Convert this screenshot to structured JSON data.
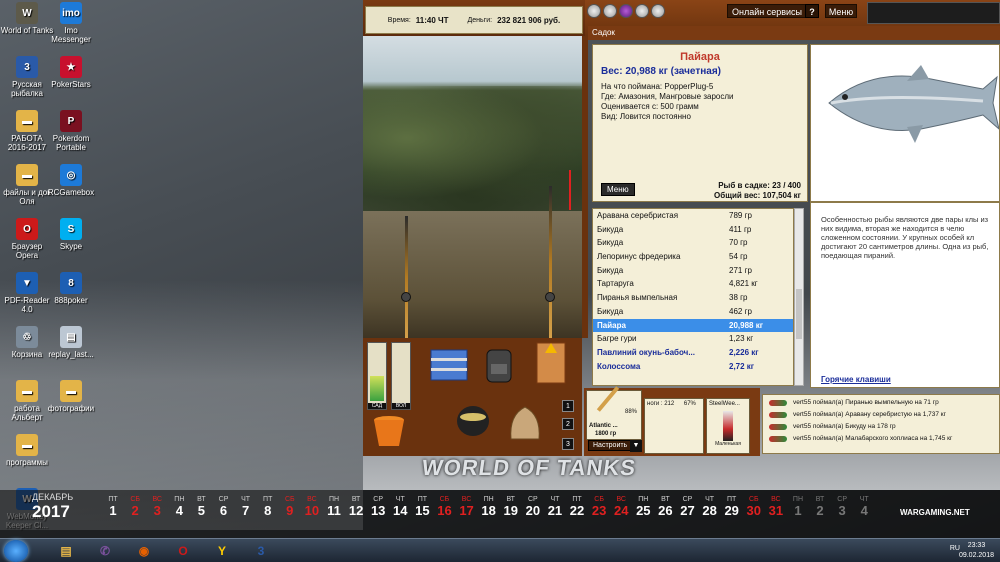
{
  "desktop": {
    "icons": [
      {
        "label": "World of Tanks",
        "glyph": "W",
        "color": "#5d5a4a"
      },
      {
        "label": "Imo Messenger",
        "glyph": "imo",
        "color": "#1d7ad8"
      },
      {
        "label": "Русская рыбалка",
        "glyph": "3",
        "color": "#2a5aa8"
      },
      {
        "label": "PokerStars",
        "glyph": "★",
        "color": "#c8102e"
      },
      {
        "label": "РАБОТА 2016-2017",
        "glyph": "▬",
        "color": "#e3b448"
      },
      {
        "label": "Pokerdom Portable",
        "glyph": "P",
        "color": "#7a1020"
      },
      {
        "label": "файлы и док Оля",
        "glyph": "▬",
        "color": "#e3b448"
      },
      {
        "label": "RCGamebox",
        "glyph": "◎",
        "color": "#1d7ad8"
      },
      {
        "label": "Браузер Opera",
        "glyph": "O",
        "color": "#cc1a1a"
      },
      {
        "label": "Skype",
        "glyph": "S",
        "color": "#00aff0"
      },
      {
        "label": "PDF-Reader 4.0",
        "glyph": "▼",
        "color": "#1d5fb3"
      },
      {
        "label": "888poker",
        "glyph": "8",
        "color": "#1d5fb3"
      },
      {
        "label": "Корзина",
        "glyph": "♲",
        "color": "#7c8b9a"
      },
      {
        "label": "replay_last...",
        "glyph": "▤",
        "color": "#bcc7d3"
      },
      {
        "label": "работа Альберт",
        "glyph": "▬",
        "color": "#e3b448"
      },
      {
        "label": "фотографии",
        "glyph": "▬",
        "color": "#e3b448"
      },
      {
        "label": "программы",
        "glyph": "▬",
        "color": "#e3b448"
      },
      {
        "label": "WebMoney Keeper Cl...",
        "glyph": "W",
        "color": "#1d5fb3"
      }
    ],
    "wallpaper_logo": "WORLD OF TANKS"
  },
  "game": {
    "time_label": "Время:",
    "time_value": "11:40 ЧТ",
    "money_label": "Деньги:",
    "money_value": "232 821 906 руб.",
    "online_services": "Онлайн сервисы",
    "help": "?",
    "menu": "Меню",
    "sadok_title": "Садок",
    "fish": {
      "name": "Пайара",
      "weight": "Вес: 20,988 кг (зачетная)",
      "lines": [
        "На что поймана: PopperPlug-5",
        "Где: Амазония, Мангровые заросли",
        "Оценивается с: 500 грамм",
        "Вид: Ловится постоянно"
      ],
      "menu": "Меню",
      "in_net": "Рыб в садке: 23 / 400",
      "total": "Общий вес: 107,504 кг"
    },
    "description": "Особенностью рыбы являются две пары клы из них видима, вторая же находится в челю сложенном состоянии. У крупных особей кл достигают 20 сантиметров длины. Одна из рыб, поедающая пираний.",
    "hotkeys": "Горячие клавиши",
    "catch_list": [
      {
        "name": "Аравана серебристая",
        "weight": "789 гр",
        "style": ""
      },
      {
        "name": "Бикуда",
        "weight": "411 гр",
        "style": ""
      },
      {
        "name": "Бикуда",
        "weight": "70 гр",
        "style": ""
      },
      {
        "name": "Лепоринус фредерика",
        "weight": "54 гр",
        "style": ""
      },
      {
        "name": "Бикуда",
        "weight": "271 гр",
        "style": ""
      },
      {
        "name": "Тартаруга",
        "weight": "4,821 кг",
        "style": ""
      },
      {
        "name": "Пиранья вымпельная",
        "weight": "38 гр",
        "style": ""
      },
      {
        "name": "Бикуда",
        "weight": "462 гр",
        "style": ""
      },
      {
        "name": "Пайара",
        "weight": "20,988 кг",
        "style": "sel"
      },
      {
        "name": "Багре гури",
        "weight": "1,23 кг",
        "style": ""
      },
      {
        "name": "Павлиний окунь-бабоч...",
        "weight": "2,226 кг",
        "style": "bold"
      },
      {
        "name": "Колоссома",
        "weight": "2,72 кг",
        "style": "bold"
      }
    ],
    "gauges": [
      {
        "label": "САД",
        "level": 0.45
      },
      {
        "label": "ВОЛ",
        "level": 0.0
      }
    ],
    "slots": [
      "1",
      "2",
      "3"
    ],
    "tackle": {
      "name": "Atlantic ...",
      "weight": "1800 гр",
      "pct": "88%",
      "stat1": "ноги : 212",
      "stat2": "67%",
      "lure": "SteelWee...",
      "lure_size": "Маленькая",
      "setup": "Настроить",
      "arrow": "▼"
    },
    "log": [
      "vert55 поймал(а) Пиранью вымпельную на 71 гр",
      "vert55 поймал(а) Аравану серебристую на 1,737 кг",
      "vert55 поймал(а) Бикуду на 178 гр",
      "vert55 поймал(а) Малабарского хоплиаса на 1,745 кг"
    ]
  },
  "calendar": {
    "month": "ДЕКАБРЬ",
    "year": "2017",
    "brand": "WARGAMING.NET",
    "days": [
      {
        "wd": "ПТ",
        "d": "1",
        "t": ""
      },
      {
        "wd": "СБ",
        "d": "2",
        "t": "we"
      },
      {
        "wd": "ВС",
        "d": "3",
        "t": "we"
      },
      {
        "wd": "ПН",
        "d": "4",
        "t": ""
      },
      {
        "wd": "ВТ",
        "d": "5",
        "t": ""
      },
      {
        "wd": "СР",
        "d": "6",
        "t": ""
      },
      {
        "wd": "ЧТ",
        "d": "7",
        "t": ""
      },
      {
        "wd": "ПТ",
        "d": "8",
        "t": ""
      },
      {
        "wd": "СБ",
        "d": "9",
        "t": "we"
      },
      {
        "wd": "ВС",
        "d": "10",
        "t": "we"
      },
      {
        "wd": "ПН",
        "d": "11",
        "t": ""
      },
      {
        "wd": "ВТ",
        "d": "12",
        "t": ""
      },
      {
        "wd": "СР",
        "d": "13",
        "t": ""
      },
      {
        "wd": "ЧТ",
        "d": "14",
        "t": ""
      },
      {
        "wd": "ПТ",
        "d": "15",
        "t": ""
      },
      {
        "wd": "СБ",
        "d": "16",
        "t": "we"
      },
      {
        "wd": "ВС",
        "d": "17",
        "t": "we"
      },
      {
        "wd": "ПН",
        "d": "18",
        "t": ""
      },
      {
        "wd": "ВТ",
        "d": "19",
        "t": ""
      },
      {
        "wd": "СР",
        "d": "20",
        "t": ""
      },
      {
        "wd": "ЧТ",
        "d": "21",
        "t": ""
      },
      {
        "wd": "ПТ",
        "d": "22",
        "t": ""
      },
      {
        "wd": "СБ",
        "d": "23",
        "t": "we"
      },
      {
        "wd": "ВС",
        "d": "24",
        "t": "we"
      },
      {
        "wd": "ПН",
        "d": "25",
        "t": ""
      },
      {
        "wd": "ВТ",
        "d": "26",
        "t": ""
      },
      {
        "wd": "СР",
        "d": "27",
        "t": ""
      },
      {
        "wd": "ЧТ",
        "d": "28",
        "t": ""
      },
      {
        "wd": "ПТ",
        "d": "29",
        "t": ""
      },
      {
        "wd": "СБ",
        "d": "30",
        "t": "we"
      },
      {
        "wd": "ВС",
        "d": "31",
        "t": "we"
      },
      {
        "wd": "ПН",
        "d": "1",
        "t": "dim"
      },
      {
        "wd": "ВТ",
        "d": "2",
        "t": "dim"
      },
      {
        "wd": "СР",
        "d": "3",
        "t": "dim"
      },
      {
        "wd": "ЧТ",
        "d": "4",
        "t": "dim"
      }
    ]
  },
  "taskbar": {
    "lang": "RU",
    "time": "23:33",
    "date": "09.02.2018",
    "apps": [
      {
        "name": "explorer",
        "glyph": "▤",
        "color": "#e3b448"
      },
      {
        "name": "viber",
        "glyph": "✆",
        "color": "#7b519d"
      },
      {
        "name": "firefox",
        "glyph": "◉",
        "color": "#e66000"
      },
      {
        "name": "opera",
        "glyph": "O",
        "color": "#cc1a1a"
      },
      {
        "name": "yandex",
        "glyph": "Y",
        "color": "#ffcc00"
      },
      {
        "name": "fishing",
        "glyph": "3",
        "color": "#2a5aa8"
      }
    ]
  }
}
